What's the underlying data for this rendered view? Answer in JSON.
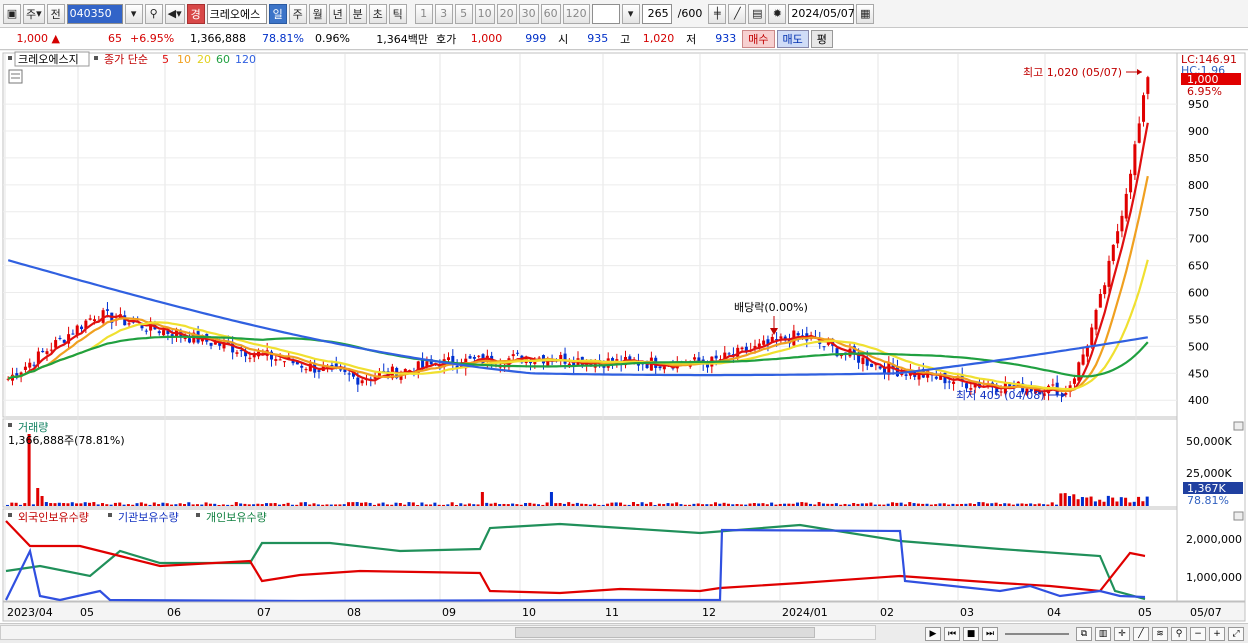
{
  "toolbar": {
    "type_label": "주",
    "prev_label": "전",
    "code": "040350",
    "badge": "경",
    "stock_name": "크레오에스",
    "periods": [
      "일",
      "주",
      "월",
      "년",
      "분",
      "초",
      "틱"
    ],
    "active_period": "일",
    "multipliers": [
      "1",
      "3",
      "5",
      "10",
      "20",
      "30",
      "60",
      "120"
    ],
    "count": "265",
    "total": "/600",
    "date": "2024/05/07"
  },
  "quote": {
    "price": "1,000",
    "arrow": "▲",
    "change": "65",
    "change_pct": "+6.95%",
    "volume": "1,366,888",
    "vol_ratio": "78.81%",
    "turnover": "0.96%",
    "amount": "1,364백만",
    "hoga_label": "호가",
    "ask": "1,000",
    "bid": "999",
    "open_label": "시",
    "open": "935",
    "high_label": "고",
    "high": "1,020",
    "low_label": "저",
    "low": "933",
    "buy_label": "매수",
    "sell_label": "매도",
    "eval_label": "평"
  },
  "price_panel": {
    "legend_name": "크레오에스지",
    "legend_ma_label": "종가 단순",
    "ma_periods": [
      "5",
      "10",
      "20",
      "60",
      "120"
    ],
    "ma_colors": [
      "#e01010",
      "#f0a020",
      "#f0e030",
      "#20a040",
      "#3060e0"
    ],
    "lc_label": "LC:146.91",
    "hc_label": "HC:1.96",
    "current_price_tag": "1,000",
    "current_pct_tag": "6.95%",
    "high_annotation": "최고 1,020 (05/07)",
    "low_annotation": "최저 405 (04/08)",
    "dividend_annotation": "배당락(0.00%)",
    "y_ticks": [
      "950",
      "900",
      "850",
      "800",
      "750",
      "700",
      "650",
      "600",
      "550",
      "500",
      "450",
      "400"
    ]
  },
  "volume_panel": {
    "title": "거래량",
    "value_label": "1,366,888주(78.81%)",
    "y_ticks": [
      "50,000K",
      "25,000K"
    ],
    "current_tag": "1,367K",
    "current_pct": "78.81%"
  },
  "holding_panel": {
    "legend": [
      "외국인보유수량",
      "기관보유수량",
      "개인보유수량"
    ],
    "y_ticks": [
      "2,000,000",
      "1,000,000"
    ]
  },
  "x_axis": {
    "labels": [
      "2023/04",
      "05",
      "06",
      "07",
      "08",
      "09",
      "10",
      "11",
      "12",
      "2024/01",
      "02",
      "03",
      "04",
      "05",
      "05/07"
    ]
  },
  "chart_data": {
    "type": "candlestick",
    "title": "",
    "xlabel": "",
    "ylabel": "",
    "ylim": [
      380,
      1030
    ],
    "months": [
      "2023/04",
      "05",
      "06",
      "07",
      "08",
      "09",
      "10",
      "11",
      "12",
      "2024/01",
      "02",
      "03",
      "04",
      "05"
    ],
    "ma120_endpoints": [
      660,
      505
    ],
    "monthly_close_estimate": [
      440,
      560,
      520,
      480,
      440,
      470,
      480,
      470,
      470,
      520,
      460,
      430,
      420,
      1000
    ],
    "last_close": 1000,
    "period_high": 1020,
    "period_low": 405
  }
}
